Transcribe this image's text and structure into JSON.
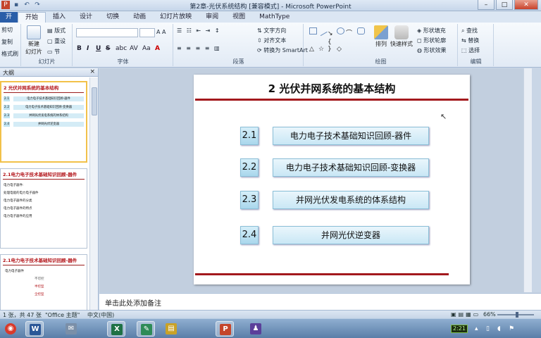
{
  "window": {
    "title": "第2章-光伏系统结构 [兼容模式] - Microsoft PowerPoint"
  },
  "tabs": [
    {
      "label": "开始"
    },
    {
      "label": "插入"
    },
    {
      "label": "设计"
    },
    {
      "label": "切换"
    },
    {
      "label": "动画"
    },
    {
      "label": "幻灯片放映"
    },
    {
      "label": "审阅"
    },
    {
      "label": "视图"
    },
    {
      "label": "MathType"
    }
  ],
  "file_tab": "开",
  "ribbon": {
    "clipboard": {
      "cut": "剪切",
      "copy": "复制",
      "format_painter": "格式刷"
    },
    "slides": {
      "new_slide": "新建",
      "new_slide2": "幻灯片",
      "layout": "版式",
      "reset": "重设",
      "section": "节",
      "group_label": "幻灯片"
    },
    "font": {
      "group_label": "字体",
      "bold": "B",
      "italic": "I",
      "underline": "U",
      "strike": "S",
      "shadow": "abc",
      "spacing": "AV",
      "case": "Aa",
      "color": "A"
    },
    "paragraph": {
      "text_direction": "文字方向",
      "align_text": "对齐文本",
      "smartart": "转换为 SmartArt",
      "group_label": "段落"
    },
    "drawing": {
      "arrange": "排列",
      "quick_styles": "快速样式",
      "shape_fill": "形状填充",
      "shape_outline": "形状轮廓",
      "shape_effects": "形状效果",
      "group_label": "绘图"
    },
    "editing": {
      "find": "查找",
      "replace": "替换",
      "select": "选择",
      "group_label": "编辑"
    }
  },
  "left_pane": {
    "tab_label": "大纲",
    "close": "×",
    "thumbs": [
      {
        "title": "2 光伏并网系统的基本结构",
        "rows": [
          {
            "num": "2.1",
            "label": "电力电子技术基础知识回顾-器件"
          },
          {
            "num": "2.2",
            "label": "电力电子技术基础知识回顾-变换器"
          },
          {
            "num": "2.3",
            "label": "并网光伏发电系统的体系结构"
          },
          {
            "num": "2.4",
            "label": "并网光伏逆变器"
          }
        ]
      },
      {
        "title": "2.1电力电子技术基础知识回顾-器件",
        "bullets": [
          "电力电子器件:",
          "处理电能的电力电子器件",
          "电力电子器件的分类",
          "电力电子器件的特点",
          "电力电子器件的应用"
        ]
      },
      {
        "title": "2.1电力电子技术基础知识回顾-器件",
        "bullets": [
          "电力电子器件",
          "不可控",
          "半控型",
          "全控型"
        ]
      }
    ]
  },
  "slide": {
    "title": "2  光伏并网系统的基本结构",
    "items": [
      {
        "num": "2.1",
        "label": "电力电子技术基础知识回顾-器件"
      },
      {
        "num": "2.2",
        "label": "电力电子技术基础知识回顾-变换器"
      },
      {
        "num": "2.3",
        "label": "并网光伏发电系统的体系结构"
      },
      {
        "num": "2.4",
        "label": "并网光伏逆变器"
      }
    ]
  },
  "notes_placeholder": "单击此处添加备注",
  "status": {
    "slide_info": "1 张，共 47 张",
    "theme": "\"Office 主题\"",
    "language": "中文(中国)",
    "zoom": "66%"
  },
  "taskbar": {
    "clock": "2:21",
    "apps": [
      {
        "name": "chrome",
        "color": "#d93a2b",
        "glyph": "◉"
      },
      {
        "name": "word",
        "color": "#2b5797",
        "glyph": "W"
      },
      {
        "name": "mail",
        "color": "#7a8fa8",
        "glyph": "✉"
      },
      {
        "name": "excel",
        "color": "#1e7145",
        "glyph": "X"
      },
      {
        "name": "notes",
        "color": "#2e8b57",
        "glyph": "✎"
      },
      {
        "name": "folder",
        "color": "#c9a227",
        "glyph": "▤"
      },
      {
        "name": "powerpoint",
        "color": "#c4452b",
        "glyph": "P"
      },
      {
        "name": "people",
        "color": "#5b3f9a",
        "glyph": "♟"
      }
    ]
  }
}
